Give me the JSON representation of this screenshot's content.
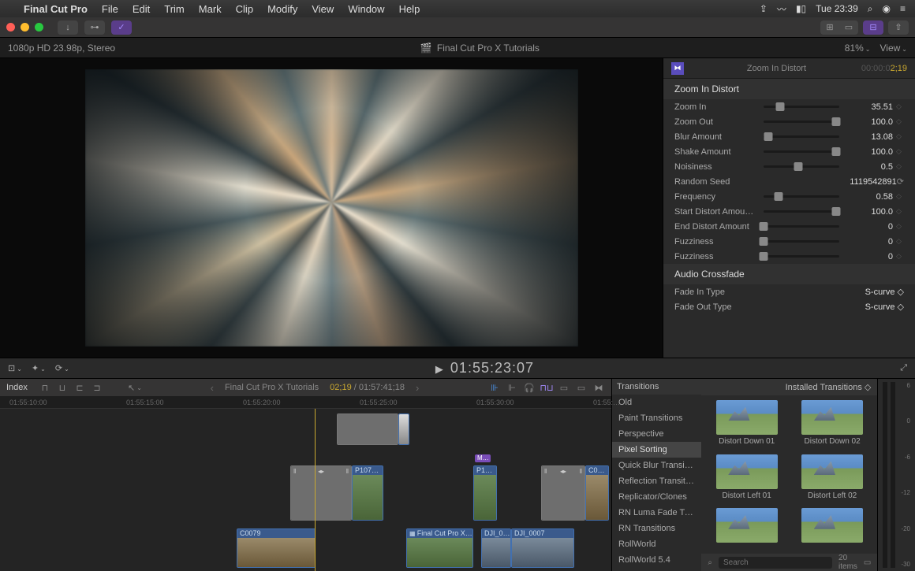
{
  "menubar": {
    "app": "Final Cut Pro",
    "items": [
      "File",
      "Edit",
      "Trim",
      "Mark",
      "Clip",
      "Modify",
      "View",
      "Window",
      "Help"
    ],
    "clock": "Tue 23:39"
  },
  "viewer": {
    "format": "1080p HD 23.98p, Stereo",
    "title": "Final Cut Pro X Tutorials",
    "zoom_pct": "81%",
    "view_label": "View"
  },
  "inspector": {
    "title": "Zoom In Distort",
    "timecode_dim": "00:00:0",
    "timecode": "2;19",
    "section": "Zoom In Distort",
    "params": [
      {
        "label": "Zoom In",
        "val": "35.51",
        "pos": 22
      },
      {
        "label": "Zoom Out",
        "val": "100.0",
        "pos": 96
      },
      {
        "label": "Blur Amount",
        "val": "13.08",
        "pos": 6
      },
      {
        "label": "Shake Amount",
        "val": "100.0",
        "pos": 96
      },
      {
        "label": "Noisiness",
        "val": "0.5",
        "pos": 46
      },
      {
        "label": "Random Seed",
        "val": "1119542891",
        "pos": null,
        "refresh": true
      },
      {
        "label": "Frequency",
        "val": "0.58",
        "pos": 20
      },
      {
        "label": "Start Distort Amou…",
        "val": "100.0",
        "pos": 96
      },
      {
        "label": "End Distort Amount",
        "val": "0",
        "pos": 0
      },
      {
        "label": "Fuzziness",
        "val": "0",
        "pos": 0
      },
      {
        "label": "Fuzziness",
        "val": "0",
        "pos": 0
      }
    ],
    "audio_section": "Audio Crossfade",
    "fade_in_label": "Fade In Type",
    "fade_out_label": "Fade Out Type",
    "fade_in": "S-curve",
    "fade_out": "S-curve"
  },
  "transport": {
    "timecode": "01:55:23:07"
  },
  "timeline": {
    "index_label": "Index",
    "title": "Final Cut Pro X Tutorials",
    "current": "02;19",
    "duration": "01:57:41;18",
    "ruler": [
      "01:55:10:00",
      "01:55:15:00",
      "01:55:20:00",
      "01:55:25:00",
      "01:55:30:00",
      "01:55:…"
    ],
    "marker": "M…",
    "clips": {
      "p107": "P107…",
      "p1": "P1…",
      "c0": "C0…",
      "c0079": "C0079",
      "fcpx": "Final Cut Pro X…",
      "dji0": "DJI_0…",
      "dji0007": "DJI_0007"
    }
  },
  "browser": {
    "header": "Transitions",
    "installed": "Installed Transitions",
    "categories": [
      "Old",
      "Paint Transitions",
      "Perspective",
      "Pixel Sorting",
      "Quick Blur Transitions",
      "Reflection Transitions",
      "Replicator/Clones",
      "RN Luma Fade Transitions",
      "RN Transitions",
      "RollWorld",
      "RollWorld 5.4"
    ],
    "selected_cat": "Pixel Sorting",
    "thumbs": [
      "Distort Down 01",
      "Distort Down 02",
      "Distort Left 01",
      "Distort Left 02",
      "",
      ""
    ],
    "items_count": "20 items",
    "search_placeholder": "Search"
  },
  "meter": {
    "labels": [
      "6",
      "0",
      "-6",
      "-12",
      "-20",
      "-30"
    ]
  }
}
